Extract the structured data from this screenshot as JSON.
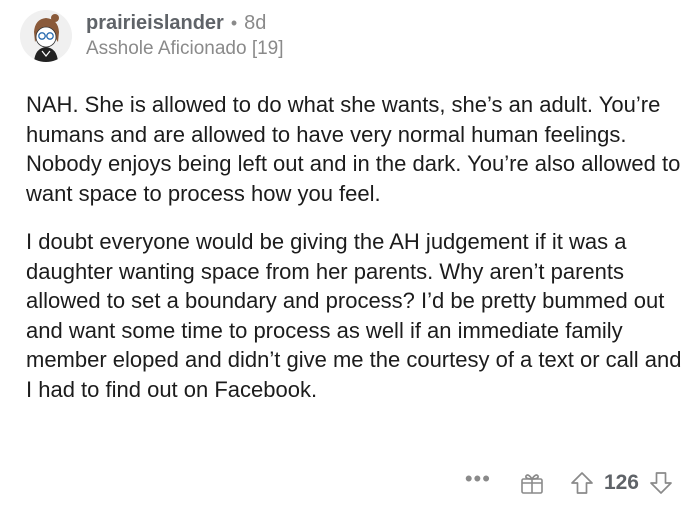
{
  "comment": {
    "username": "prairieislander",
    "separator": "•",
    "age": "8d",
    "flair": "Asshole Aficionado [19]",
    "paragraphs": [
      "NAH. She is allowed to do what she wants, she’s an adult. You’re humans and are allowed to have very normal human feelings. Nobody enjoys being left out and in the dark. You’re also allowed to want space to process how you feel.",
      "I doubt everyone would be giving the AH judgement if it was a daughter wanting space from her parents. Why aren’t parents allowed to set a boundary and process? I’d be pretty bummed out and want some time to process as well if an immediate family member eloped and didn’t give me the courtesy of a text or call and I had to find out on Facebook."
    ],
    "actions": {
      "more_label": "•••",
      "vote_count": "126"
    }
  },
  "icons": {
    "avatar": "avatar",
    "award": "gift-icon",
    "upvote": "upvote-arrow-icon",
    "downvote": "downvote-arrow-icon"
  },
  "colors": {
    "text_primary": "#1c1c1c",
    "text_muted": "#8a8a8a",
    "username": "#5f6368"
  }
}
